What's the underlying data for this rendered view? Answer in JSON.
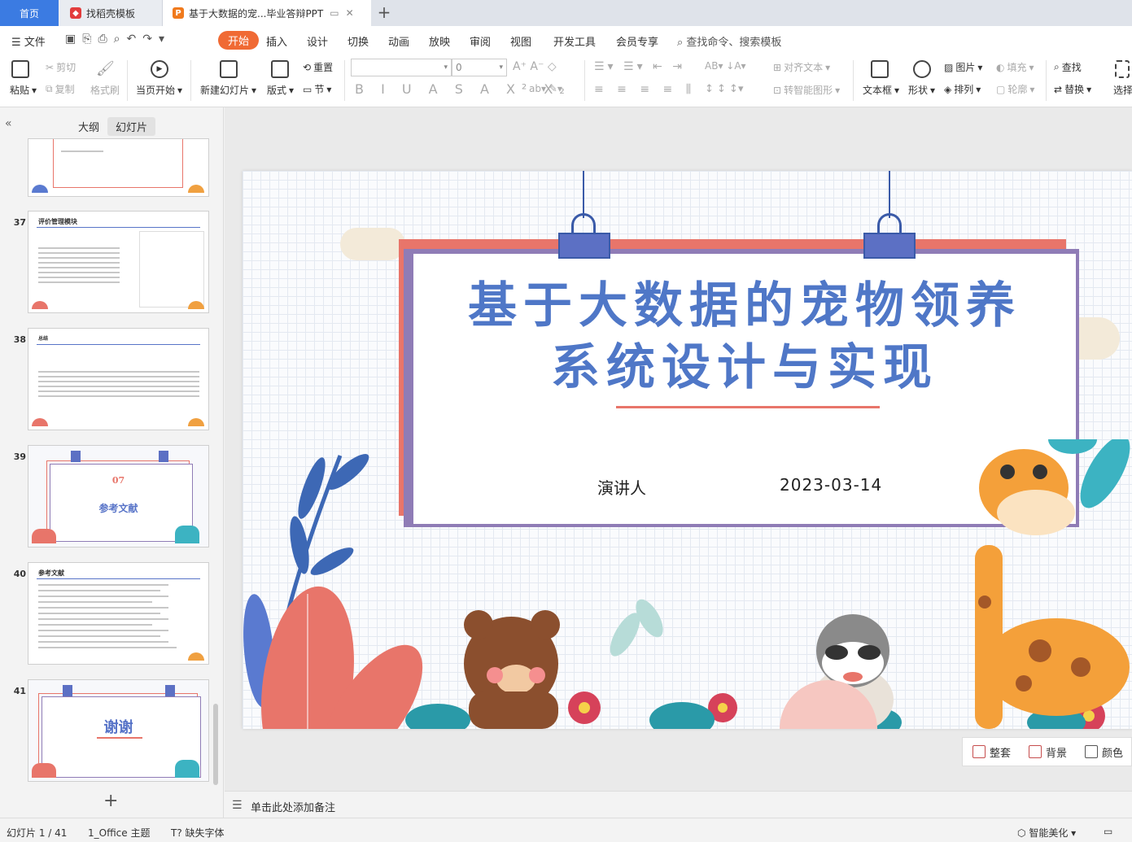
{
  "tabs": {
    "home": "首页",
    "template": "找稻壳模板",
    "doc": "基于大数据的宠...毕业答辩PPT"
  },
  "menu": {
    "file": "文件",
    "items": [
      "开始",
      "插入",
      "设计",
      "切换",
      "动画",
      "放映",
      "审阅",
      "视图",
      "开发工具",
      "会员专享"
    ],
    "search": "查找命令、搜索模板"
  },
  "ribbon": {
    "paste": "粘贴",
    "cut": "剪切",
    "copy": "复制",
    "format_painter": "格式刷",
    "play_current": "当页开始",
    "new_slide": "新建幻灯片",
    "layout": "版式",
    "reset": "重置",
    "section": "节",
    "font_size": "0",
    "text_align": "对齐文本",
    "smart_graphic": "转智能图形",
    "textbox": "文本框",
    "shape": "形状",
    "picture": "图片",
    "arrange": "排列",
    "fill": "填充",
    "outline": "轮廓",
    "find": "查找",
    "replace": "替换",
    "select": "选择"
  },
  "left_panel": {
    "tab_outline": "大纲",
    "tab_slides": "幻灯片",
    "thumbs": [
      {
        "num": "",
        "title": ""
      },
      {
        "num": "37",
        "title": "评价管理模块"
      },
      {
        "num": "38",
        "title": "总结"
      },
      {
        "num": "39",
        "title": "参考文献",
        "sub": "07"
      },
      {
        "num": "40",
        "title": "参考文献"
      },
      {
        "num": "41",
        "title": "谢谢"
      }
    ]
  },
  "slide": {
    "title_line1": "基于大数据的宠物领养",
    "title_line2": "系统设计与实现",
    "presenter": "演讲人",
    "date": "2023-03-14"
  },
  "slide_tools": {
    "tidy": "整套",
    "background": "背景",
    "color": "颜色"
  },
  "notes": {
    "placeholder": "单击此处添加备注"
  },
  "status": {
    "slide_count": "幻灯片 1 / 41",
    "theme": "1_Office 主题",
    "missing_font": "缺失字体",
    "beautify": "智能美化"
  }
}
